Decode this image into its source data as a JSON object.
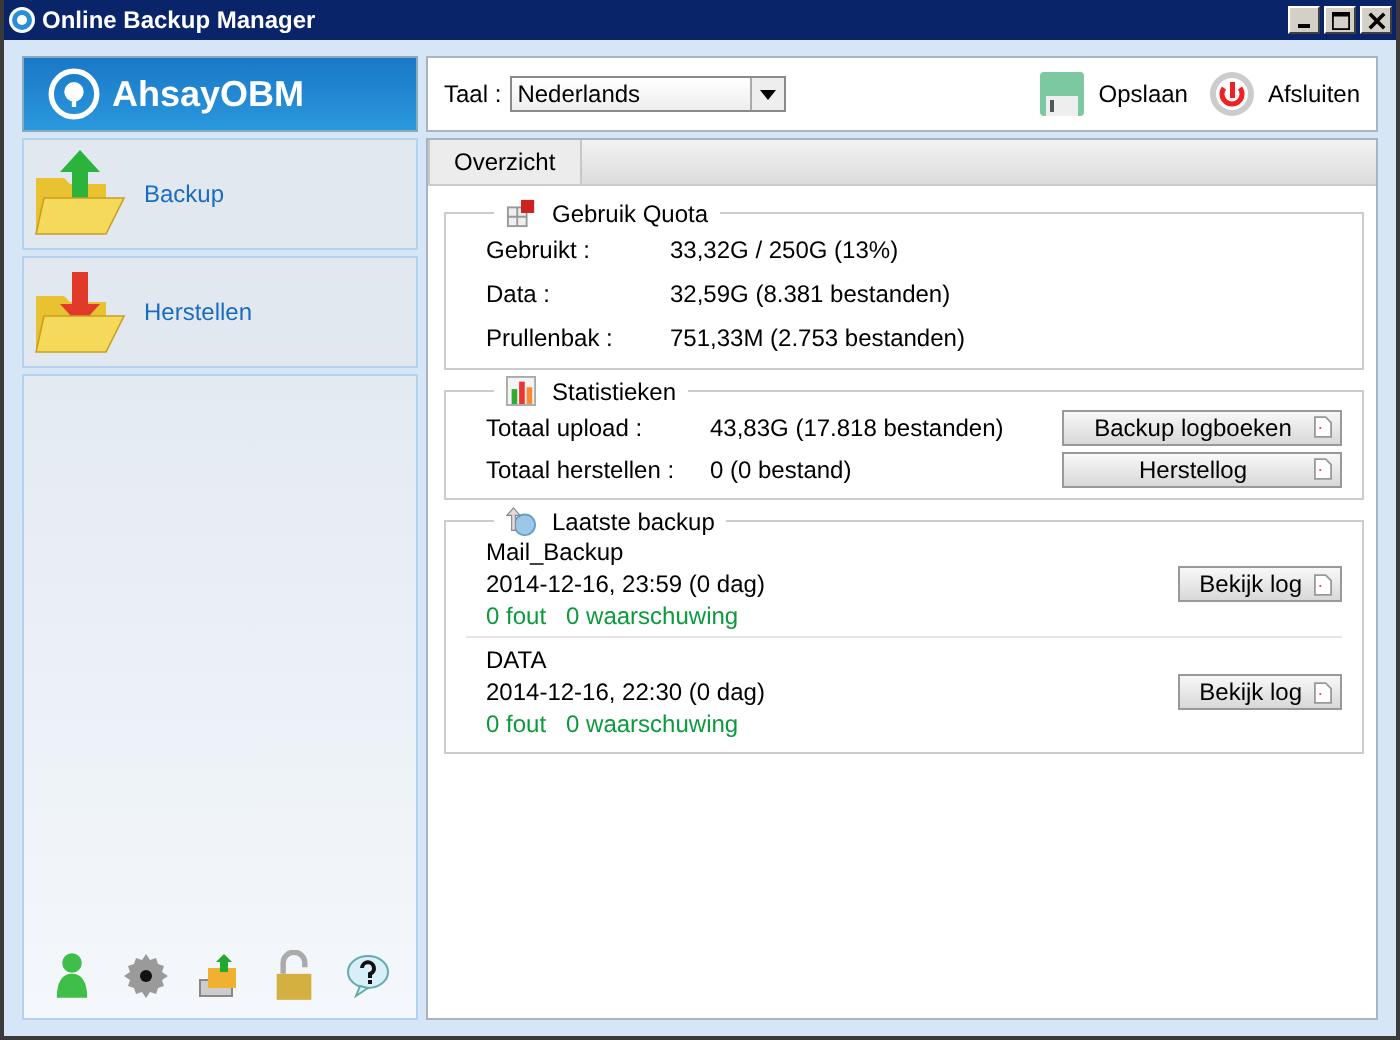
{
  "window": {
    "title": "Online Backup Manager"
  },
  "logo": {
    "text": "AhsayOBM"
  },
  "sidebar": {
    "items": [
      {
        "kind": "backup",
        "label": "Backup"
      },
      {
        "kind": "restore",
        "label": "Herstellen"
      }
    ]
  },
  "toolbar": {
    "language_label": "Taal :",
    "language": "Nederlands",
    "buttons": [
      {
        "kind": "save",
        "label": "Opslaan"
      },
      {
        "kind": "exit",
        "label": "Afsluiten"
      }
    ]
  },
  "tabs": [
    {
      "label": "Overzicht",
      "selected": true
    }
  ],
  "quota": {
    "title": "Gebruik Quota",
    "rows": [
      {
        "label": "Gebruikt :",
        "value": "33,32G / 250G (13%)"
      },
      {
        "label": "Data :",
        "value": "32,59G  (8.381 bestanden)"
      },
      {
        "label": "Prullenbak :",
        "value": "751,33M  (2.753 bestanden)"
      }
    ]
  },
  "statistics": {
    "title": "Statistieken",
    "rows": [
      {
        "label": "Totaal upload :",
        "value": "43,83G  (17.818 bestanden)",
        "button": "Backup logboeken"
      },
      {
        "label": "Totaal herstellen :",
        "value": "0  (0 bestand)",
        "button": "Herstellog"
      }
    ]
  },
  "latest_backup": {
    "title": "Laatste backup",
    "items": [
      {
        "name": "Mail_Backup",
        "time": "2014-12-16, 23:59 (0 dag)",
        "errors": "0 fout",
        "warnings": "0 waarschuwing",
        "button": "Bekijk log"
      },
      {
        "name": "DATA",
        "time": "2014-12-16, 22:30 (0 dag)",
        "errors": "0 fout",
        "warnings": "0 waarschuwing",
        "button": "Bekijk log"
      }
    ]
  }
}
